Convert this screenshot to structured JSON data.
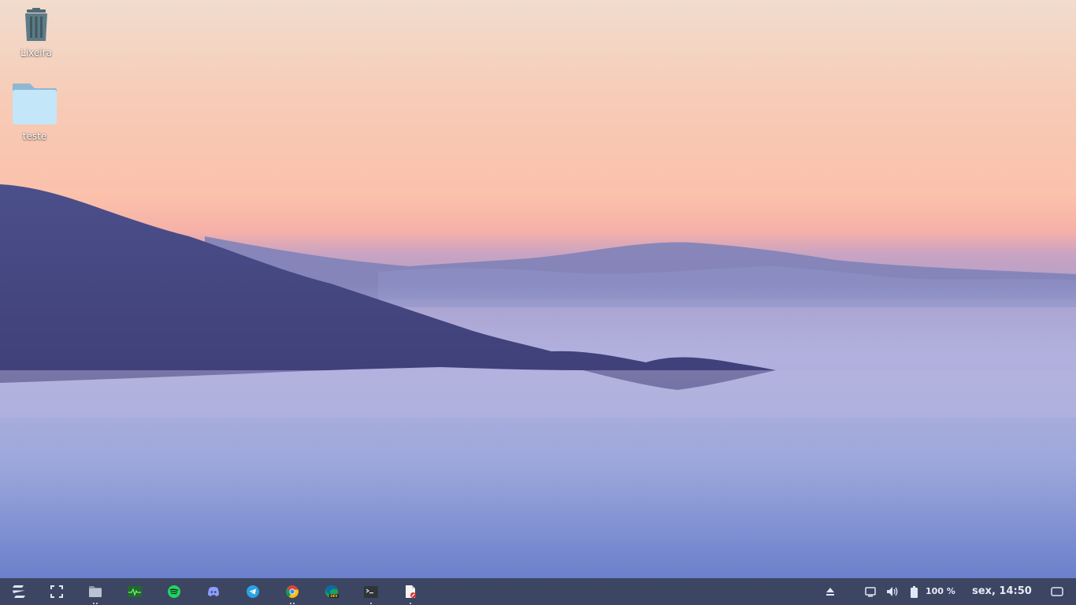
{
  "desktop": {
    "icons": [
      {
        "label": "Lixeira",
        "icon": "trash-icon"
      },
      {
        "label": "teste",
        "icon": "folder-icon"
      }
    ]
  },
  "taskbar": {
    "apps": [
      {
        "name": "zorin-menu",
        "icon": "zorin-logo-icon"
      },
      {
        "name": "workspaces",
        "icon": "fullscreen-icon"
      },
      {
        "name": "files",
        "icon": "folder-icon"
      },
      {
        "name": "system-monitor",
        "icon": "system-monitor-icon"
      },
      {
        "name": "spotify",
        "icon": "spotify-icon"
      },
      {
        "name": "discord",
        "icon": "discord-icon"
      },
      {
        "name": "telegram",
        "icon": "telegram-icon"
      },
      {
        "name": "chrome",
        "icon": "chrome-icon"
      },
      {
        "name": "edge-dev",
        "icon": "edge-dev-icon"
      },
      {
        "name": "terminal",
        "icon": "terminal-icon"
      },
      {
        "name": "document-viewer",
        "icon": "document-viewer-icon"
      }
    ],
    "tray": {
      "battery_percent": "100 %",
      "clock": "sex, 14:50"
    }
  },
  "colors": {
    "taskbar_bg": "#3c4562",
    "sky_top": "#f3d9c8",
    "sky_glow": "#f8b7a6",
    "fog": "#9ea4da"
  }
}
